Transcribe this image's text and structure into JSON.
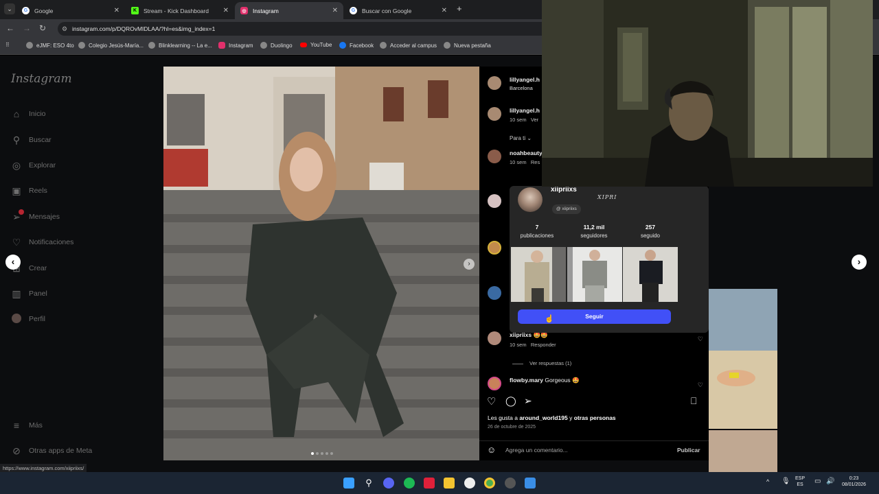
{
  "browser": {
    "tabs": [
      {
        "label": "Google",
        "icon": "google-icon",
        "color": "#ffffff"
      },
      {
        "label": "Stream - Kick Dashboard",
        "icon": "kick-icon",
        "color": "#53fc18"
      },
      {
        "label": "Instagram",
        "icon": "instagram-icon",
        "color": "#e1306c"
      },
      {
        "label": "Buscar con Google",
        "icon": "google-icon",
        "color": "#ffffff"
      }
    ],
    "url": "instagram.com/p/DQROvMIDLAA/?hl=es&img_index=1",
    "bookmarks": [
      {
        "label": "eJMF: ESO 4to",
        "color": "#dddddd"
      },
      {
        "label": "Colegio Jesús-María...",
        "color": "#dddddd"
      },
      {
        "label": "Blinklearning -- La e...",
        "color": "#dddddd"
      },
      {
        "label": "Instagram",
        "color": "#e1306c"
      },
      {
        "label": "Duolingo",
        "color": "#dddddd"
      },
      {
        "label": "YouTube",
        "color": "#ff0000"
      },
      {
        "label": "Facebook",
        "color": "#1877f2"
      },
      {
        "label": "Acceder al campus",
        "color": "#dddddd"
      },
      {
        "label": "Nueva pestaña",
        "color": "#dddddd"
      }
    ],
    "status_url": "https://www.instagram.com/xiipriixs/"
  },
  "sidebar": {
    "logo": "Instagram",
    "items": [
      {
        "label": "Inicio",
        "icon": "home-icon"
      },
      {
        "label": "Buscar",
        "icon": "search-icon"
      },
      {
        "label": "Explorar",
        "icon": "compass-icon"
      },
      {
        "label": "Reels",
        "icon": "reels-icon"
      },
      {
        "label": "Mensajes",
        "icon": "messages-icon"
      },
      {
        "label": "Notificaciones",
        "icon": "heart-icon"
      },
      {
        "label": "Crear",
        "icon": "plus-icon"
      },
      {
        "label": "Panel",
        "icon": "chart-icon"
      },
      {
        "label": "Perfil",
        "icon": "avatar-icon"
      }
    ],
    "more": "Más",
    "meta": "Otras apps de Meta"
  },
  "post": {
    "author": "lillyangel.h",
    "location": "Barcelona",
    "caption_author": "lillyangel.h",
    "caption_time": "10 sem",
    "caption_extra": "Ver",
    "para_ti": "Para ti",
    "comments": [
      {
        "user": "noahbeauty",
        "time": "10 sem",
        "extra": "Res"
      },
      {
        "user": "xiipriixs",
        "text": "🤩🤩",
        "time": "10 sem",
        "reply": "Responder",
        "replies": "Ver respuestas (1)"
      },
      {
        "user": "flowby.mary",
        "text": "Gorgeous 🤩"
      }
    ],
    "likes_prefix": "Les gusta a",
    "likes_user": "around_world195",
    "likes_middle": "y",
    "likes_others": "otras personas",
    "date": "26 de octubre de 2025",
    "comment_placeholder": "Agrega un comentario...",
    "publish": "Publicar"
  },
  "profile_card": {
    "username": "xiipriixs",
    "bio": "XIPRI",
    "threads": "xiipriixs",
    "stats": [
      {
        "value": "7",
        "label": "publicaciones"
      },
      {
        "value": "11,2 mil",
        "label": "seguidores"
      },
      {
        "value": "257",
        "label": "seguido"
      }
    ],
    "follow": "Seguir"
  },
  "taskbar": {
    "lang": "ESP",
    "lang_sub": "ES",
    "time": "0:23",
    "date": "08/01/2026"
  }
}
